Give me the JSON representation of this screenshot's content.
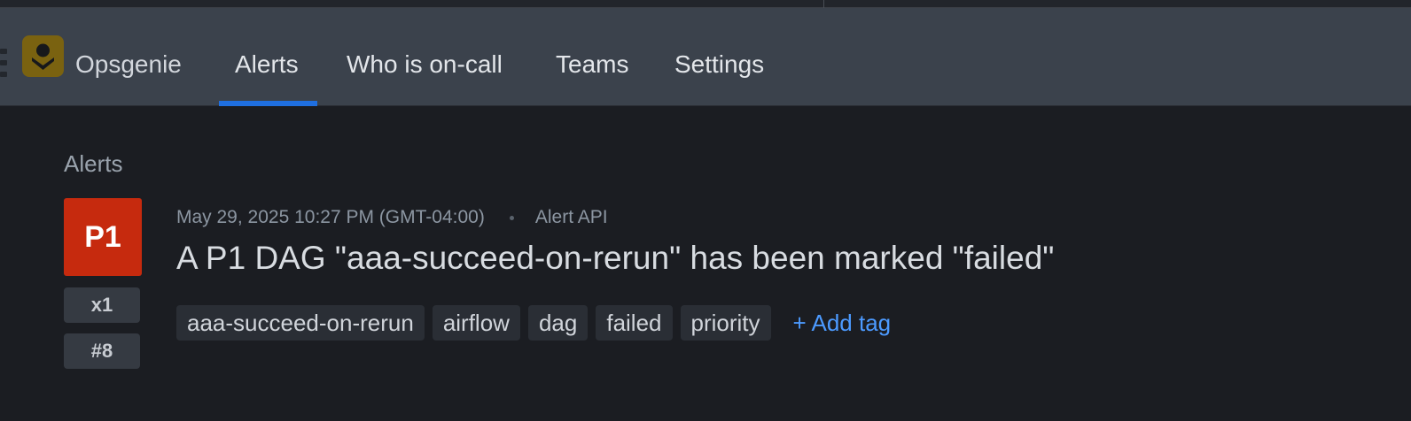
{
  "app": {
    "brand_name": "Opsgenie",
    "logo_icon": "opsgenie-logo-icon",
    "colors": {
      "navbar_bg": "#3b424c",
      "page_bg": "#1b1d22",
      "active_underline": "#1f6fe0",
      "priority_p1": "#c62a0e",
      "link": "#4c9aff"
    }
  },
  "nav": {
    "items": [
      {
        "label": "Alerts",
        "active": true
      },
      {
        "label": "Who is on-call",
        "active": false
      },
      {
        "label": "Teams",
        "active": false
      },
      {
        "label": "Settings",
        "active": false
      }
    ]
  },
  "breadcrumb": "Alerts",
  "alert": {
    "priority": "P1",
    "count": "x1",
    "tiny_id": "#8",
    "created_at": "May 29, 2025 10:27 PM (GMT-04:00)",
    "source": "Alert API",
    "title": "A P1 DAG \"aaa-succeed-on-rerun\" has been marked \"failed\"",
    "tags": [
      "aaa-succeed-on-rerun",
      "airflow",
      "dag",
      "failed",
      "priority"
    ],
    "add_tag_label": "+ Add tag"
  }
}
